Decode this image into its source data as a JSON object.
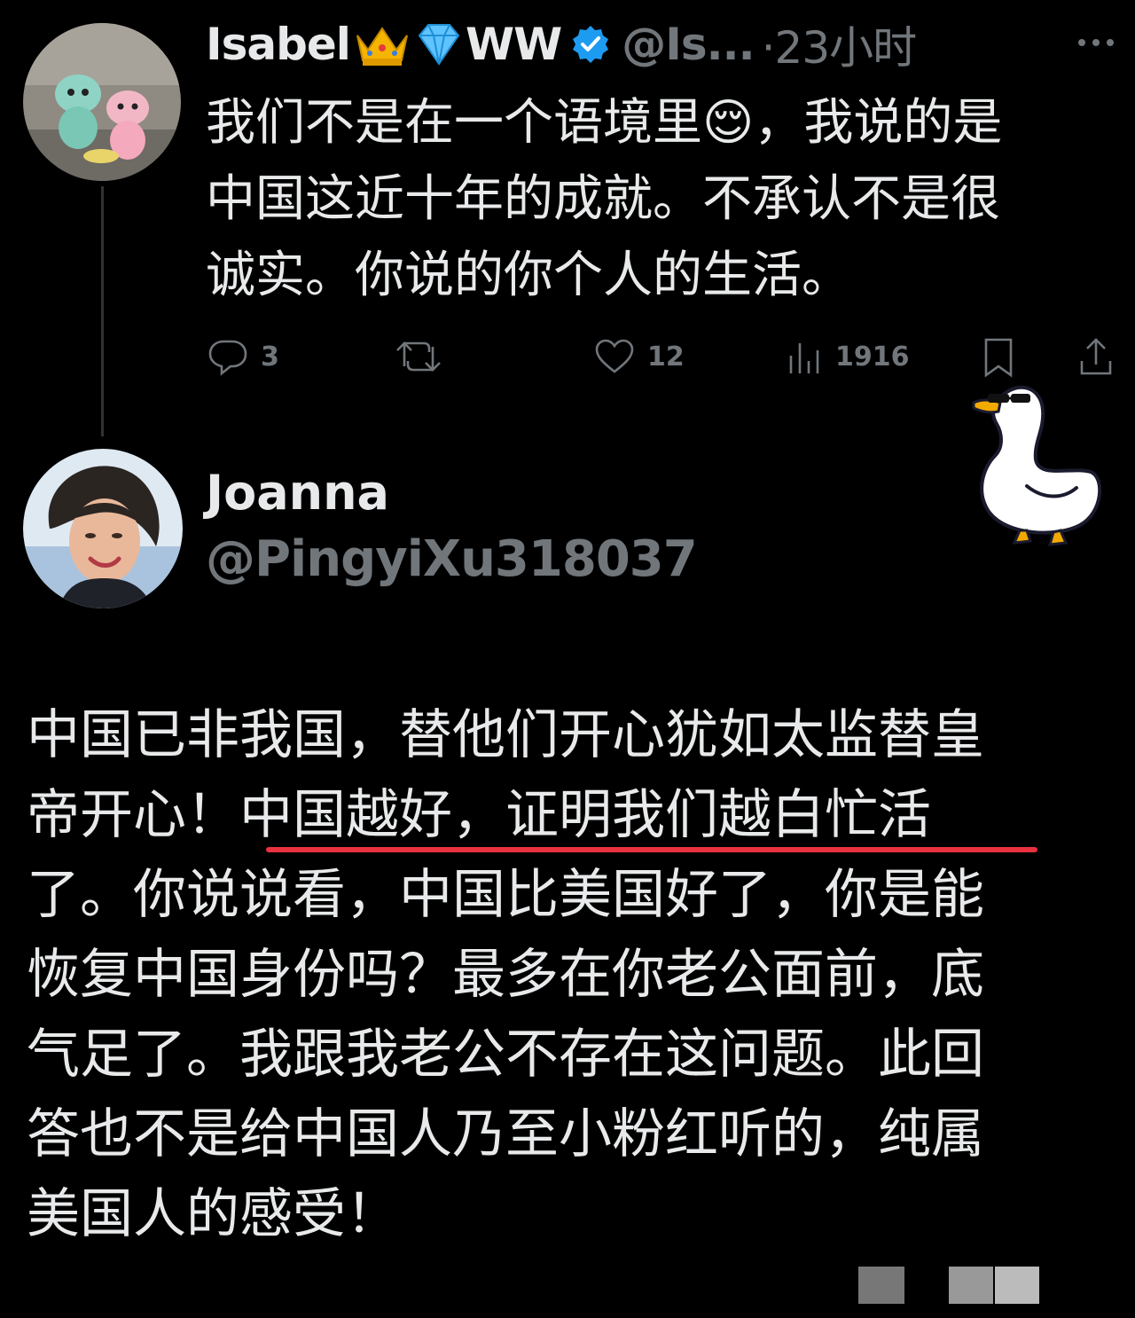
{
  "tweet1": {
    "display_name": "Isabel",
    "name_suffix": "WW",
    "handle": "@Is...",
    "time": "·23小时",
    "text_lines": [
      "我们不是在一个语境里😌，我说的是",
      "中国这近十年的成就。不承认不是很",
      "诚实。你说的你个人的生活。"
    ],
    "actions": {
      "reply_count": "3",
      "repost_count": "",
      "like_count": "12",
      "views_count": "1916"
    }
  },
  "tweet2": {
    "display_name": "Joanna",
    "handle": "@PingyiXu318037",
    "text_lines": [
      "中国已非我国，替他们开心犹如太监替皇",
      "帝开心！中国越好，证明我们越白忙活",
      "了。你说说看，中国比美国好了，你是能",
      "恢复中国身份吗？最多在你老公面前，底",
      "气足了。我跟我老公不存在这问题。此回",
      "答也不是给中国人乃至小粉红听的，纯属",
      "美国人的感受！"
    ],
    "highlighted_phrase": "中国越好，证明我们越白忙活"
  },
  "colors": {
    "background": "#000000",
    "text": "#e7e9ea",
    "secondary": "#71767b",
    "verified": "#1d9bf0",
    "underline": "#e8323f"
  }
}
